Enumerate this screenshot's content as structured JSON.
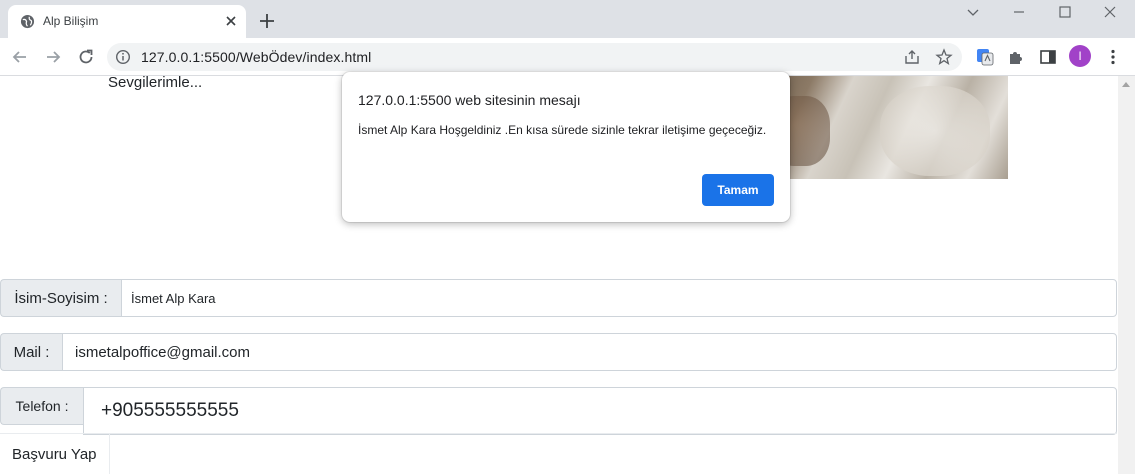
{
  "browser": {
    "tab": {
      "title": "Alp Bilişim"
    },
    "address": {
      "url": "127.0.0.1:5500/WebÖdev/index.html"
    },
    "profile": {
      "initial": "I",
      "color": "#a142c8"
    }
  },
  "page": {
    "signoff": "Sevgilerimle...",
    "form": {
      "name": {
        "label": "İsim-Soyisim :",
        "value": "İsmet Alp Kara"
      },
      "mail": {
        "label": "Mail :",
        "value": "ismetalpoffice@gmail.com"
      },
      "phone": {
        "label": "Telefon :",
        "value": "+905555555555"
      },
      "submit_label": "Başvuru Yap"
    }
  },
  "dialog": {
    "title": "127.0.0.1:5500 web sitesinin mesajı",
    "message": "İsmet Alp Kara Hoşgeldiniz .En kısa sürede sizinle tekrar iletişime geçeceğiz.",
    "ok_label": "Tamam",
    "accent": "#1a73e8"
  }
}
